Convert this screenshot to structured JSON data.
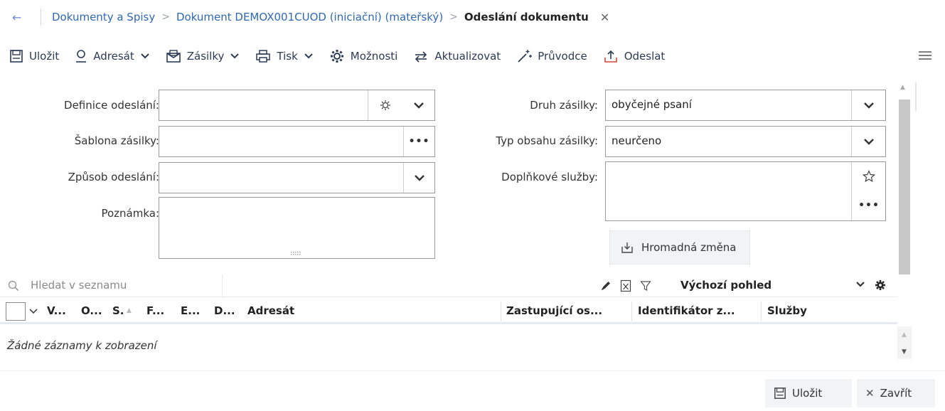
{
  "breadcrumb": {
    "items": [
      "Dokumenty a Spisy",
      "Dokument DEMOX001CUOD (iniciační) (mateřský)"
    ],
    "current": "Odeslání dokumentu"
  },
  "toolbar": {
    "save": "Uložit",
    "recipient": "Adresát",
    "shipments": "Zásilky",
    "print": "Tisk",
    "options": "Možnosti",
    "refresh": "Aktualizovat",
    "wizard": "Průvodce",
    "send": "Odeslat"
  },
  "form": {
    "send_definition": {
      "label": "Definice odeslání:",
      "value": ""
    },
    "shipment_template": {
      "label": "Šablona zásilky:",
      "value": ""
    },
    "send_method": {
      "label": "Způsob odeslání:",
      "value": ""
    },
    "note": {
      "label": "Poznámka:",
      "value": ""
    },
    "shipment_kind": {
      "label": "Druh zásilky:",
      "value": "obyčejné psaní"
    },
    "content_type": {
      "label": "Typ obsahu zásilky:",
      "value": "neurčeno"
    },
    "extra_services": {
      "label": "Doplňkové služby:",
      "value": ""
    },
    "bulk_change": "Hromadná změna"
  },
  "list": {
    "search_placeholder": "Hledat v seznamu",
    "view_name": "Výchozí pohled",
    "columns": [
      "V...",
      "O...",
      "S.",
      "F...",
      "E...",
      "D...",
      "Adresát",
      "Zastupující os...",
      "Identifikátor z...",
      "Služby"
    ],
    "empty_text": "Žádné záznamy k zobrazení"
  },
  "footer": {
    "save": "Uložit",
    "close": "Zavřít"
  }
}
